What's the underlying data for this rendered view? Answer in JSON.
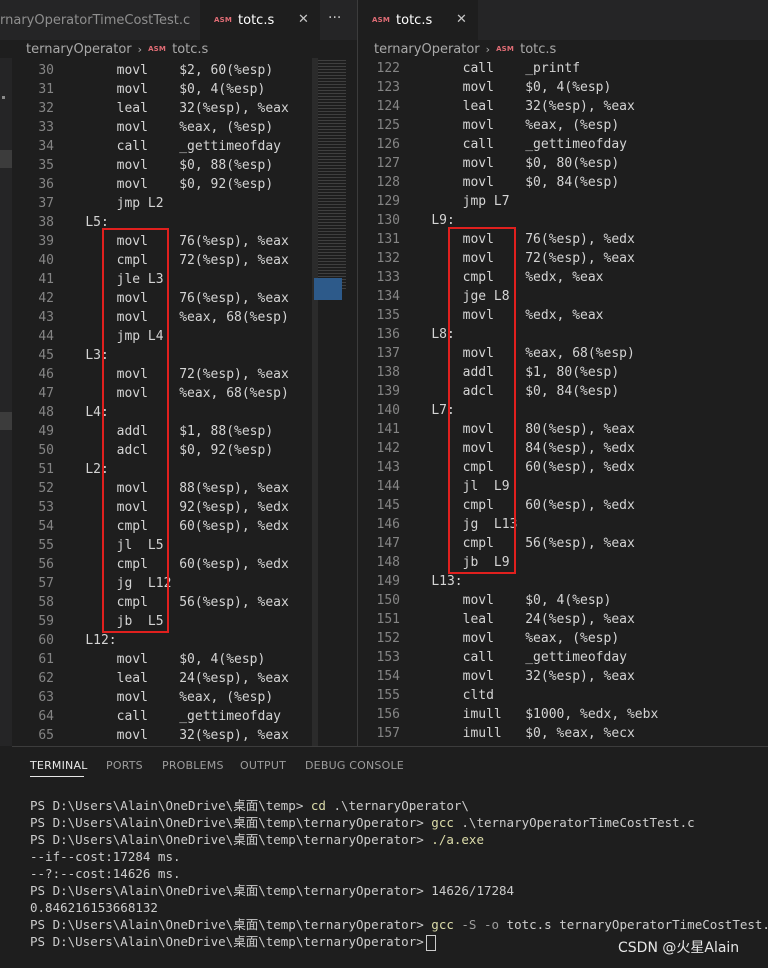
{
  "tabs": {
    "left": [
      {
        "label": "rnaryOperatorTimeCostTest.c"
      },
      {
        "badge": "ASM",
        "label": "totc.s"
      }
    ],
    "more": "···",
    "right": {
      "badge": "ASM",
      "label": "totc.s"
    },
    "close": "✕"
  },
  "breadcrumb_left": {
    "folder": "ternaryOperator",
    "sep": "›",
    "badge": "ASM",
    "file": "totc.s"
  },
  "breadcrumb_right": {
    "folder": "ternaryOperator",
    "sep": "›",
    "badge": "ASM",
    "file": "totc.s"
  },
  "left_lines": [
    {
      "n": "30",
      "t": "    movl    $2, 60(%esp)"
    },
    {
      "n": "31",
      "t": "    movl    $0, 4(%esp)"
    },
    {
      "n": "32",
      "t": "    leal    32(%esp), %eax"
    },
    {
      "n": "33",
      "t": "    movl    %eax, (%esp)"
    },
    {
      "n": "34",
      "t": "    call    _gettimeofday"
    },
    {
      "n": "35",
      "t": "    movl    $0, 88(%esp)"
    },
    {
      "n": "36",
      "t": "    movl    $0, 92(%esp)"
    },
    {
      "n": "37",
      "t": "    jmp L2"
    },
    {
      "n": "38",
      "t": "L5:"
    },
    {
      "n": "39",
      "t": "    movl    76(%esp), %eax"
    },
    {
      "n": "40",
      "t": "    cmpl    72(%esp), %eax"
    },
    {
      "n": "41",
      "t": "    jle L3"
    },
    {
      "n": "42",
      "t": "    movl    76(%esp), %eax"
    },
    {
      "n": "43",
      "t": "    movl    %eax, 68(%esp)"
    },
    {
      "n": "44",
      "t": "    jmp L4"
    },
    {
      "n": "45",
      "t": "L3:"
    },
    {
      "n": "46",
      "t": "    movl    72(%esp), %eax"
    },
    {
      "n": "47",
      "t": "    movl    %eax, 68(%esp)"
    },
    {
      "n": "48",
      "t": "L4:"
    },
    {
      "n": "49",
      "t": "    addl    $1, 88(%esp)"
    },
    {
      "n": "50",
      "t": "    adcl    $0, 92(%esp)"
    },
    {
      "n": "51",
      "t": "L2:"
    },
    {
      "n": "52",
      "t": "    movl    88(%esp), %eax"
    },
    {
      "n": "53",
      "t": "    movl    92(%esp), %edx"
    },
    {
      "n": "54",
      "t": "    cmpl    60(%esp), %edx"
    },
    {
      "n": "55",
      "t": "    jl  L5"
    },
    {
      "n": "56",
      "t": "    cmpl    60(%esp), %edx"
    },
    {
      "n": "57",
      "t": "    jg  L12"
    },
    {
      "n": "58",
      "t": "    cmpl    56(%esp), %eax"
    },
    {
      "n": "59",
      "t": "    jb  L5"
    },
    {
      "n": "60",
      "t": "L12:"
    },
    {
      "n": "61",
      "t": "    movl    $0, 4(%esp)"
    },
    {
      "n": "62",
      "t": "    leal    24(%esp), %eax"
    },
    {
      "n": "63",
      "t": "    movl    %eax, (%esp)"
    },
    {
      "n": "64",
      "t": "    call    _gettimeofday"
    },
    {
      "n": "65",
      "t": "    movl    32(%esp), %eax"
    }
  ],
  "right_lines": [
    {
      "n": "122",
      "t": "    call    _printf"
    },
    {
      "n": "123",
      "t": "    movl    $0, 4(%esp)"
    },
    {
      "n": "124",
      "t": "    leal    32(%esp), %eax"
    },
    {
      "n": "125",
      "t": "    movl    %eax, (%esp)"
    },
    {
      "n": "126",
      "t": "    call    _gettimeofday"
    },
    {
      "n": "127",
      "t": "    movl    $0, 80(%esp)"
    },
    {
      "n": "128",
      "t": "    movl    $0, 84(%esp)"
    },
    {
      "n": "129",
      "t": "    jmp L7"
    },
    {
      "n": "130",
      "t": "L9:"
    },
    {
      "n": "131",
      "t": "    movl    76(%esp), %edx"
    },
    {
      "n": "132",
      "t": "    movl    72(%esp), %eax"
    },
    {
      "n": "133",
      "t": "    cmpl    %edx, %eax"
    },
    {
      "n": "134",
      "t": "    jge L8"
    },
    {
      "n": "135",
      "t": "    movl    %edx, %eax"
    },
    {
      "n": "136",
      "t": "L8:"
    },
    {
      "n": "137",
      "t": "    movl    %eax, 68(%esp)"
    },
    {
      "n": "138",
      "t": "    addl    $1, 80(%esp)"
    },
    {
      "n": "139",
      "t": "    adcl    $0, 84(%esp)"
    },
    {
      "n": "140",
      "t": "L7:"
    },
    {
      "n": "141",
      "t": "    movl    80(%esp), %eax"
    },
    {
      "n": "142",
      "t": "    movl    84(%esp), %edx"
    },
    {
      "n": "143",
      "t": "    cmpl    60(%esp), %edx"
    },
    {
      "n": "144",
      "t": "    jl  L9"
    },
    {
      "n": "145",
      "t": "    cmpl    60(%esp), %edx"
    },
    {
      "n": "146",
      "t": "    jg  L13"
    },
    {
      "n": "147",
      "t": "    cmpl    56(%esp), %eax"
    },
    {
      "n": "148",
      "t": "    jb  L9"
    },
    {
      "n": "149",
      "t": "L13:"
    },
    {
      "n": "150",
      "t": "    movl    $0, 4(%esp)"
    },
    {
      "n": "151",
      "t": "    leal    24(%esp), %eax"
    },
    {
      "n": "152",
      "t": "    movl    %eax, (%esp)"
    },
    {
      "n": "153",
      "t": "    call    _gettimeofday"
    },
    {
      "n": "154",
      "t": "    movl    32(%esp), %eax"
    },
    {
      "n": "155",
      "t": "    cltd"
    },
    {
      "n": "156",
      "t": "    imull   $1000, %edx, %ebx"
    },
    {
      "n": "157",
      "t": "    imull   $0, %eax, %ecx"
    }
  ],
  "panel_tabs": [
    "TERMINAL",
    "PORTS",
    "PROBLEMS",
    "OUTPUT",
    "DEBUG CONSOLE"
  ],
  "terminal": {
    "l1_prompt": "PS D:\\Users\\Alain\\OneDrive\\桌面\\temp>",
    "l1_cmd": "cd",
    "l1_arg": " .\\ternaryOperator\\",
    "l2_prompt": "PS D:\\Users\\Alain\\OneDrive\\桌面\\temp\\ternaryOperator>",
    "l2_cmd": "gcc",
    "l2_arg": " .\\ternaryOperatorTimeCostTest.c",
    "l3_prompt": "PS D:\\Users\\Alain\\OneDrive\\桌面\\temp\\ternaryOperator>",
    "l3_cmd": "./a.exe",
    "l4_out": "--if--cost:17284 ms.",
    "l5_out": "--?:--cost:14626 ms.",
    "l6_prompt": "PS D:\\Users\\Alain\\OneDrive\\桌面\\temp\\ternaryOperator>",
    "l6_arg": "14626/17284",
    "l7_out": "0.846216153668132",
    "l8_prompt": "PS D:\\Users\\Alain\\OneDrive\\桌面\\temp\\ternaryOperator>",
    "l8_cmd": "gcc",
    "l8_flag": " -S -o",
    "l8_arg": " totc.s ternaryOperatorTimeCostTest.c",
    "l9_prompt": "PS D:\\Users\\Alain\\OneDrive\\桌面\\temp\\ternaryOperator>"
  },
  "watermark": "CSDN @火星Alain"
}
